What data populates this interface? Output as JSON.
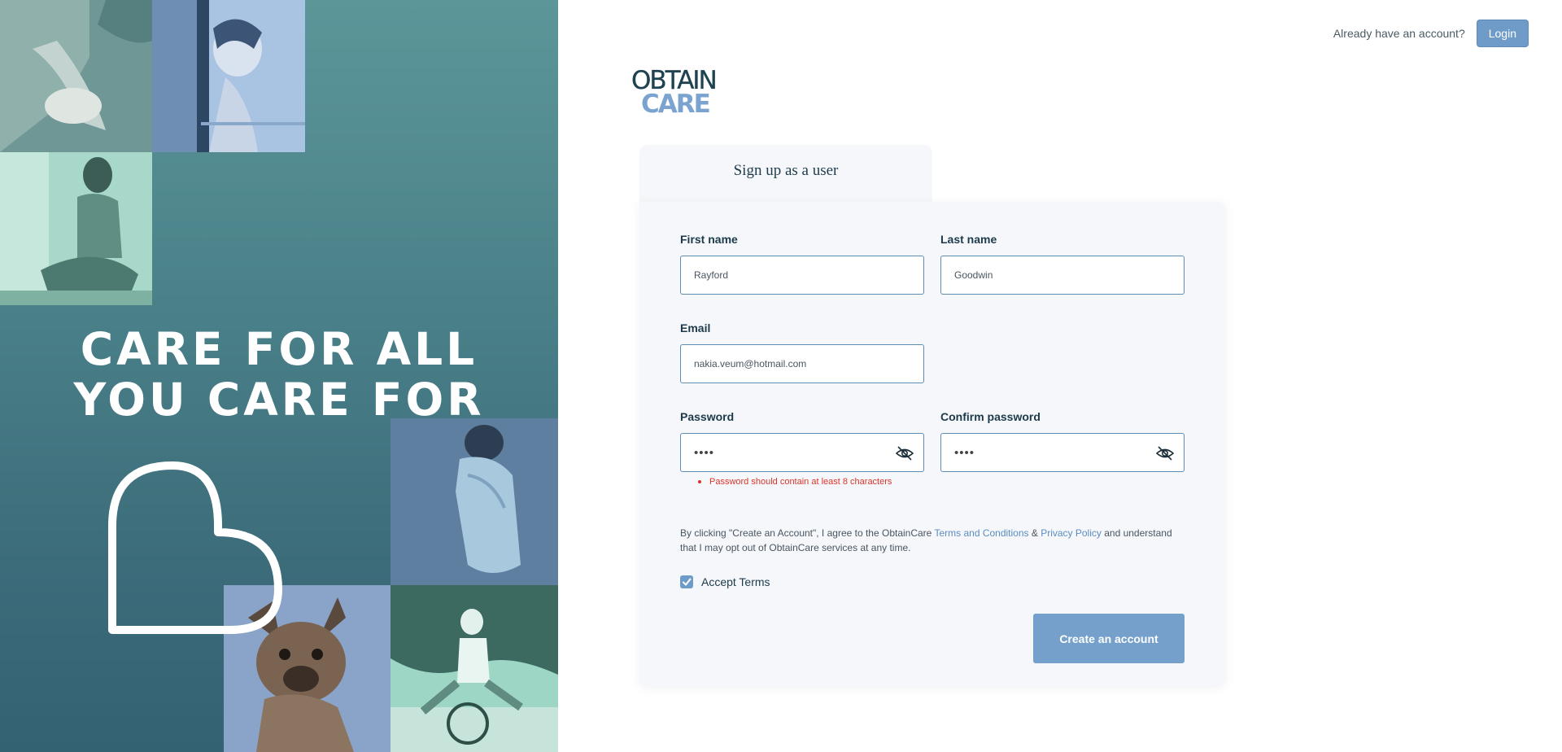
{
  "hero": {
    "tagline_line1": "CARE FOR ALL",
    "tagline_line2": "YOU CARE FOR"
  },
  "header": {
    "prompt": "Already have an account?",
    "login_label": "Login"
  },
  "logo": {
    "line1": "OBTAIN",
    "line2": "CARE"
  },
  "form": {
    "tab_label": "Sign up as a user",
    "first_name": {
      "label": "First name",
      "value": "Rayford"
    },
    "last_name": {
      "label": "Last name",
      "value": "Goodwin"
    },
    "email": {
      "label": "Email",
      "value": "nakia.veum@hotmail.com"
    },
    "password": {
      "label": "Password",
      "value": "••••"
    },
    "confirm_password": {
      "label": "Confirm password",
      "value": "••••"
    },
    "password_error": "Password should contain at least 8 characters",
    "consent": {
      "before": "By clicking \"Create an Account\", I agree to the ObtainCare ",
      "terms_link": "Terms and Conditions",
      "amp": " & ",
      "privacy_link": "Privacy Policy",
      "after": " and understand that I may opt out of ObtainCare services at any time."
    },
    "accept_label": "Accept Terms",
    "accept_checked": true,
    "submit_label": "Create an account"
  },
  "icons": {
    "password_toggle": "eye-slash-icon",
    "confirm_toggle": "eye-slash-icon",
    "checkbox": "checkmark-icon",
    "heart": "heart-outline-icon"
  },
  "colors": {
    "accent": "#6f9bc8",
    "hero_teal": "#4a8189",
    "error": "#d9342b",
    "link": "#5b8dbf"
  }
}
